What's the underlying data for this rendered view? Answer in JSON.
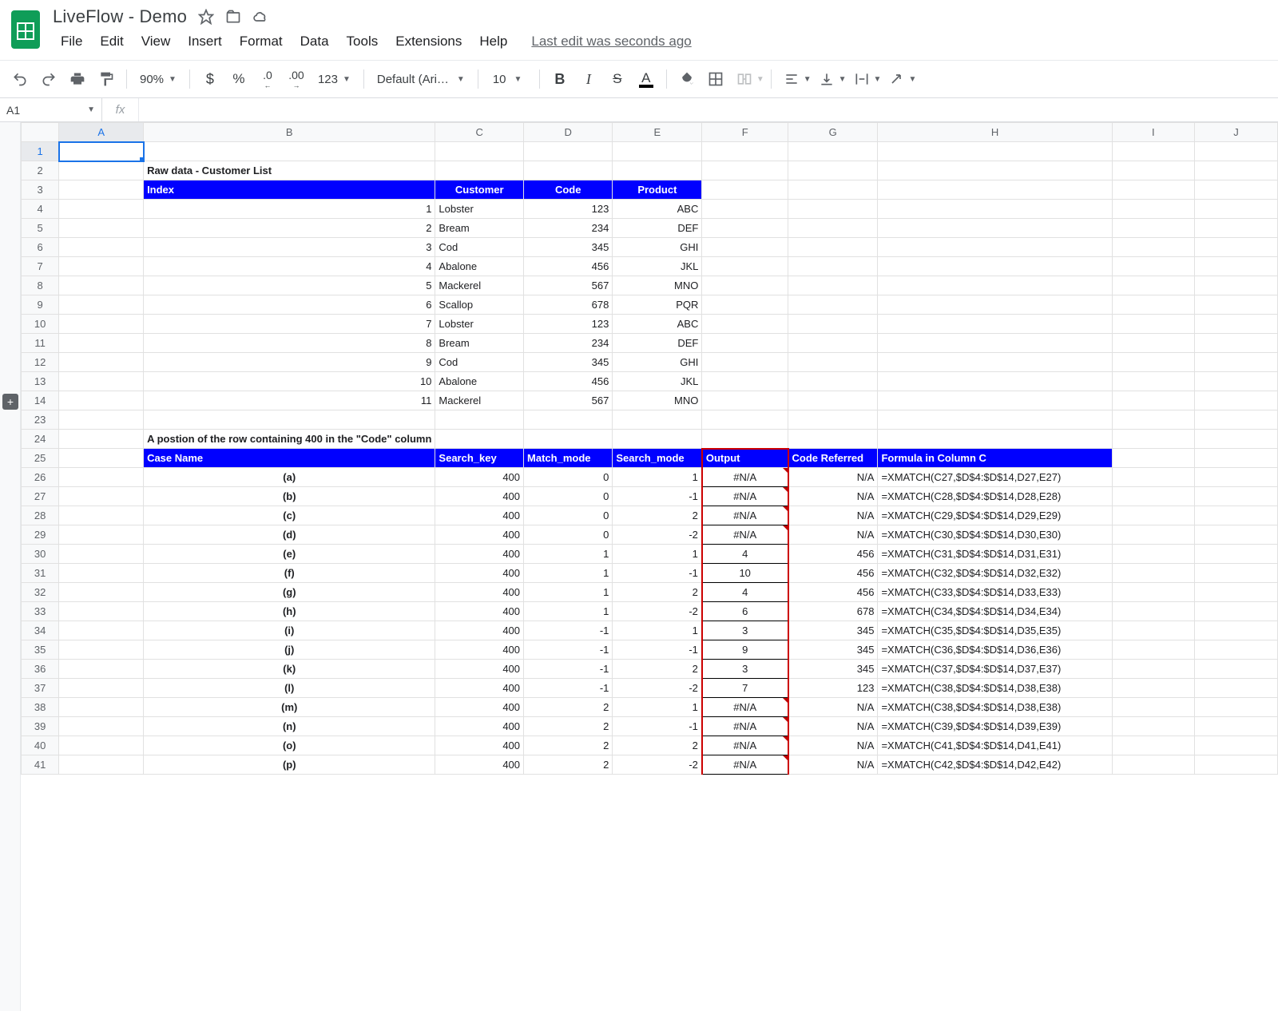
{
  "doc_title": "LiveFlow - Demo",
  "menu": {
    "file": "File",
    "edit": "Edit",
    "view": "View",
    "insert": "Insert",
    "format": "Format",
    "data": "Data",
    "tools": "Tools",
    "extensions": "Extensions",
    "help": "Help",
    "last_edit": "Last edit was seconds ago"
  },
  "toolbar": {
    "zoom": "90%",
    "font": "Default (Ari…",
    "size": "10",
    "number_123": "123"
  },
  "name_box": "A1",
  "fx": "fx",
  "cols": [
    "A",
    "B",
    "C",
    "D",
    "E",
    "F",
    "G",
    "H",
    "I",
    "J"
  ],
  "rows": [
    "1",
    "2",
    "3",
    "4",
    "5",
    "6",
    "7",
    "8",
    "9",
    "10",
    "11",
    "12",
    "13",
    "14",
    "23",
    "24",
    "25",
    "26",
    "27",
    "28",
    "29",
    "30",
    "31",
    "32",
    "33",
    "34",
    "35",
    "36",
    "37",
    "38",
    "39",
    "40",
    "41"
  ],
  "raw_title": "Raw data  - Customer List",
  "raw_headers": {
    "index": "Index",
    "customer": "Customer",
    "code": "Code",
    "product": "Product"
  },
  "raw_rows": [
    {
      "i": "1",
      "c": "Lobster",
      "code": "123",
      "p": "ABC"
    },
    {
      "i": "2",
      "c": "Bream",
      "code": "234",
      "p": "DEF"
    },
    {
      "i": "3",
      "c": "Cod",
      "code": "345",
      "p": "GHI"
    },
    {
      "i": "4",
      "c": "Abalone",
      "code": "456",
      "p": "JKL"
    },
    {
      "i": "5",
      "c": "Mackerel",
      "code": "567",
      "p": "MNO"
    },
    {
      "i": "6",
      "c": "Scallop",
      "code": "678",
      "p": "PQR"
    },
    {
      "i": "7",
      "c": "Lobster",
      "code": "123",
      "p": "ABC"
    },
    {
      "i": "8",
      "c": "Bream",
      "code": "234",
      "p": "DEF"
    },
    {
      "i": "9",
      "c": "Cod",
      "code": "345",
      "p": "GHI"
    },
    {
      "i": "10",
      "c": "Abalone",
      "code": "456",
      "p": "JKL"
    },
    {
      "i": "11",
      "c": "Mackerel",
      "code": "567",
      "p": "MNO"
    }
  ],
  "case_title": "A postion of the row containing 400 in the \"Code\" column",
  "case_headers": {
    "name": "Case Name",
    "sk": "Search_key",
    "mm": "Match_mode",
    "sm": "Search_mode",
    "out": "Output",
    "cr": "Code Referred",
    "formula": "Formula in Column C"
  },
  "cases": [
    {
      "n": "(a)",
      "sk": "400",
      "mm": "0",
      "sm": "1",
      "out": "#N/A",
      "cr": "N/A",
      "f": "=XMATCH(C27,$D$4:$D$14,D27,E27)"
    },
    {
      "n": "(b)",
      "sk": "400",
      "mm": "0",
      "sm": "-1",
      "out": "#N/A",
      "cr": "N/A",
      "f": "=XMATCH(C28,$D$4:$D$14,D28,E28)"
    },
    {
      "n": "(c)",
      "sk": "400",
      "mm": "0",
      "sm": "2",
      "out": "#N/A",
      "cr": "N/A",
      "f": "=XMATCH(C29,$D$4:$D$14,D29,E29)"
    },
    {
      "n": "(d)",
      "sk": "400",
      "mm": "0",
      "sm": "-2",
      "out": "#N/A",
      "cr": "N/A",
      "f": "=XMATCH(C30,$D$4:$D$14,D30,E30)"
    },
    {
      "n": "(e)",
      "sk": "400",
      "mm": "1",
      "sm": "1",
      "out": "4",
      "cr": "456",
      "f": "=XMATCH(C31,$D$4:$D$14,D31,E31)"
    },
    {
      "n": "(f)",
      "sk": "400",
      "mm": "1",
      "sm": "-1",
      "out": "10",
      "cr": "456",
      "f": "=XMATCH(C32,$D$4:$D$14,D32,E32)"
    },
    {
      "n": "(g)",
      "sk": "400",
      "mm": "1",
      "sm": "2",
      "out": "4",
      "cr": "456",
      "f": "=XMATCH(C33,$D$4:$D$14,D33,E33)"
    },
    {
      "n": "(h)",
      "sk": "400",
      "mm": "1",
      "sm": "-2",
      "out": "6",
      "cr": "678",
      "f": "=XMATCH(C34,$D$4:$D$14,D34,E34)"
    },
    {
      "n": "(i)",
      "sk": "400",
      "mm": "-1",
      "sm": "1",
      "out": "3",
      "cr": "345",
      "f": "=XMATCH(C35,$D$4:$D$14,D35,E35)"
    },
    {
      "n": "(j)",
      "sk": "400",
      "mm": "-1",
      "sm": "-1",
      "out": "9",
      "cr": "345",
      "f": "=XMATCH(C36,$D$4:$D$14,D36,E36)"
    },
    {
      "n": "(k)",
      "sk": "400",
      "mm": "-1",
      "sm": "2",
      "out": "3",
      "cr": "345",
      "f": "=XMATCH(C37,$D$4:$D$14,D37,E37)"
    },
    {
      "n": "(l)",
      "sk": "400",
      "mm": "-1",
      "sm": "-2",
      "out": "7",
      "cr": "123",
      "f": "=XMATCH(C38,$D$4:$D$14,D38,E38)"
    },
    {
      "n": "(m)",
      "sk": "400",
      "mm": "2",
      "sm": "1",
      "out": "#N/A",
      "cr": "N/A",
      "f": "=XMATCH(C38,$D$4:$D$14,D38,E38)"
    },
    {
      "n": "(n)",
      "sk": "400",
      "mm": "2",
      "sm": "-1",
      "out": "#N/A",
      "cr": "N/A",
      "f": "=XMATCH(C39,$D$4:$D$14,D39,E39)"
    },
    {
      "n": "(o)",
      "sk": "400",
      "mm": "2",
      "sm": "2",
      "out": "#N/A",
      "cr": "N/A",
      "f": "=XMATCH(C41,$D$4:$D$14,D41,E41)"
    },
    {
      "n": "(p)",
      "sk": "400",
      "mm": "2",
      "sm": "-2",
      "out": "#N/A",
      "cr": "N/A",
      "f": "=XMATCH(C42,$D$4:$D$14,D42,E42)"
    }
  ]
}
